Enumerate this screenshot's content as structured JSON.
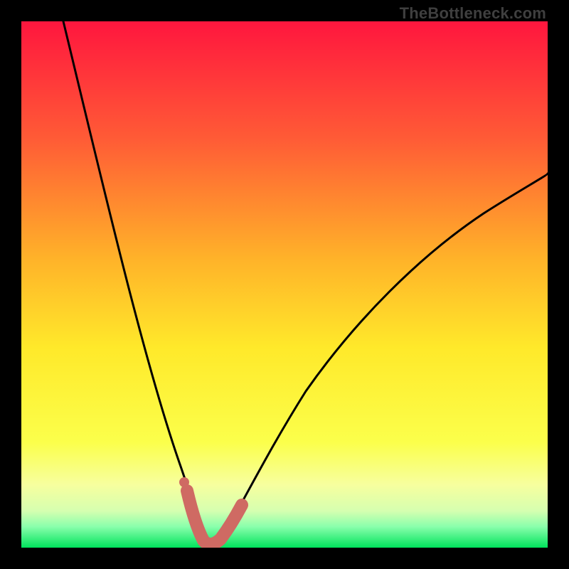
{
  "watermark": "TheBottleneck.com",
  "colors": {
    "frame_bg": "#000000",
    "curve": "#000000",
    "marker": "#cf6a63",
    "grad_top": "#ff163e",
    "grad_mid1": "#ff6f33",
    "grad_mid2": "#ffe92a",
    "grad_low1": "#f7ff8a",
    "grad_low2": "#c9ffb0",
    "grad_bottom": "#00e35c"
  },
  "chart_data": {
    "type": "line",
    "title": "",
    "xlabel": "",
    "ylabel": "",
    "xlim": [
      0,
      100
    ],
    "ylim": [
      0,
      100
    ],
    "annotations": [
      "TheBottleneck.com"
    ],
    "series": [
      {
        "name": "bottleneck-curve",
        "x": [
          8,
          10,
          12,
          14,
          16,
          18,
          20,
          22,
          24,
          26,
          28,
          30,
          31,
          32,
          33,
          34,
          35,
          36,
          38,
          40,
          44,
          48,
          52,
          56,
          60,
          64,
          68,
          72,
          76,
          80,
          84,
          88,
          92,
          96,
          100
        ],
        "y": [
          100,
          92,
          84,
          76,
          68,
          60,
          52,
          44,
          37,
          30,
          23,
          15,
          11,
          7,
          3,
          1,
          0,
          1,
          4,
          8,
          15,
          22,
          28,
          33,
          38,
          43,
          47,
          51,
          55,
          58,
          61,
          64,
          66,
          69,
          71
        ]
      },
      {
        "name": "optimal-band-markers",
        "x": [
          30.5,
          31.5,
          32.5,
          33.5,
          34.5,
          35.5,
          36.5,
          37.5,
          38.5
        ],
        "y": [
          11,
          7,
          3.5,
          1.2,
          0.5,
          0.5,
          1.5,
          3.5,
          6
        ]
      }
    ]
  }
}
